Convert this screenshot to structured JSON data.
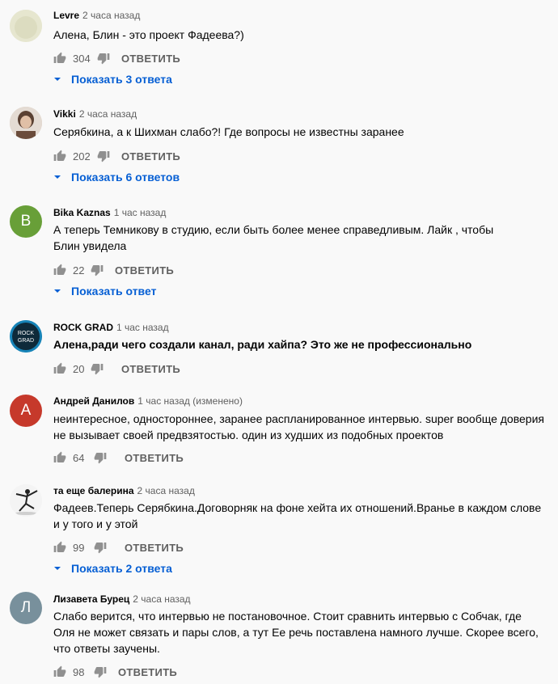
{
  "comments": [
    {
      "author": "Levre",
      "time": "2 часа назад",
      "text": "Алена, Блин - это проект Фадеева?)",
      "likes": "304",
      "reply": "ОТВЕТИТЬ",
      "replies": "Показать 3 ответа",
      "avatar_letter": "",
      "avatar_color": "#e8e8d8"
    },
    {
      "author": "Vikki",
      "time": "2 часа назад",
      "text": "Серябкина, а к Шихман слабо?! Где вопросы не известны заранее",
      "likes": "202",
      "reply": "ОТВЕТИТЬ",
      "replies": "Показать 6 ответов",
      "avatar_letter": "",
      "avatar_color": "#c8b8a8"
    },
    {
      "author": "Bika Kaznas",
      "time": "1 час назад",
      "text": "А теперь Темникову в студию, если быть более менее справедливым. Лайк , чтобы Блин увидела",
      "likes": "22",
      "reply": "ОТВЕТИТЬ",
      "replies": "Показать ответ",
      "avatar_letter": "B",
      "avatar_color": "#689f38"
    },
    {
      "author": "ROCK GRAD",
      "time": "1 час назад",
      "text": "Алена,ради чего создали канал, ради хайпа? Это же не профессионально",
      "likes": "20",
      "reply": "ОТВЕТИТЬ",
      "replies": "",
      "avatar_letter": "",
      "avatar_color": "#1a7fb0",
      "avatar_text": "ROCK GRAD"
    },
    {
      "author": "Андрей Данилов",
      "time": "1 час назад (изменено)",
      "text": "неинтересное, одностороннее, заранее распланированное интервью. super вообще доверия не вызывает своей предвзятостью. один из худших из подобных проектов",
      "likes": "64",
      "reply": "ОТВЕТИТЬ",
      "replies": "",
      "avatar_letter": "А",
      "avatar_color": "#c6392b"
    },
    {
      "author": "та еще балерина",
      "time": "2 часа назад",
      "text": "Фадеев.Теперь Серябкина.Договорняк на фоне хейта их отношений.Вранье в каждом слове и у того и у этой",
      "likes": "99",
      "reply": "ОТВЕТИТЬ",
      "replies": "Показать 2 ответа",
      "avatar_letter": "",
      "avatar_color": "#f2f2f2"
    },
    {
      "author": "Лизавета Бурец",
      "time": "2 часа назад",
      "text": "Слабо верится, что интервью не постановочное. Стоит сравнить интервью с Собчак, где Оля не может связать и пары слов, а тут Ее речь поставлена намного лучше. Скорее всего, что ответы заучены.",
      "likes": "98",
      "reply": "ОТВЕТИТЬ",
      "replies": "",
      "avatar_letter": "Л",
      "avatar_color": "#78909c"
    }
  ]
}
